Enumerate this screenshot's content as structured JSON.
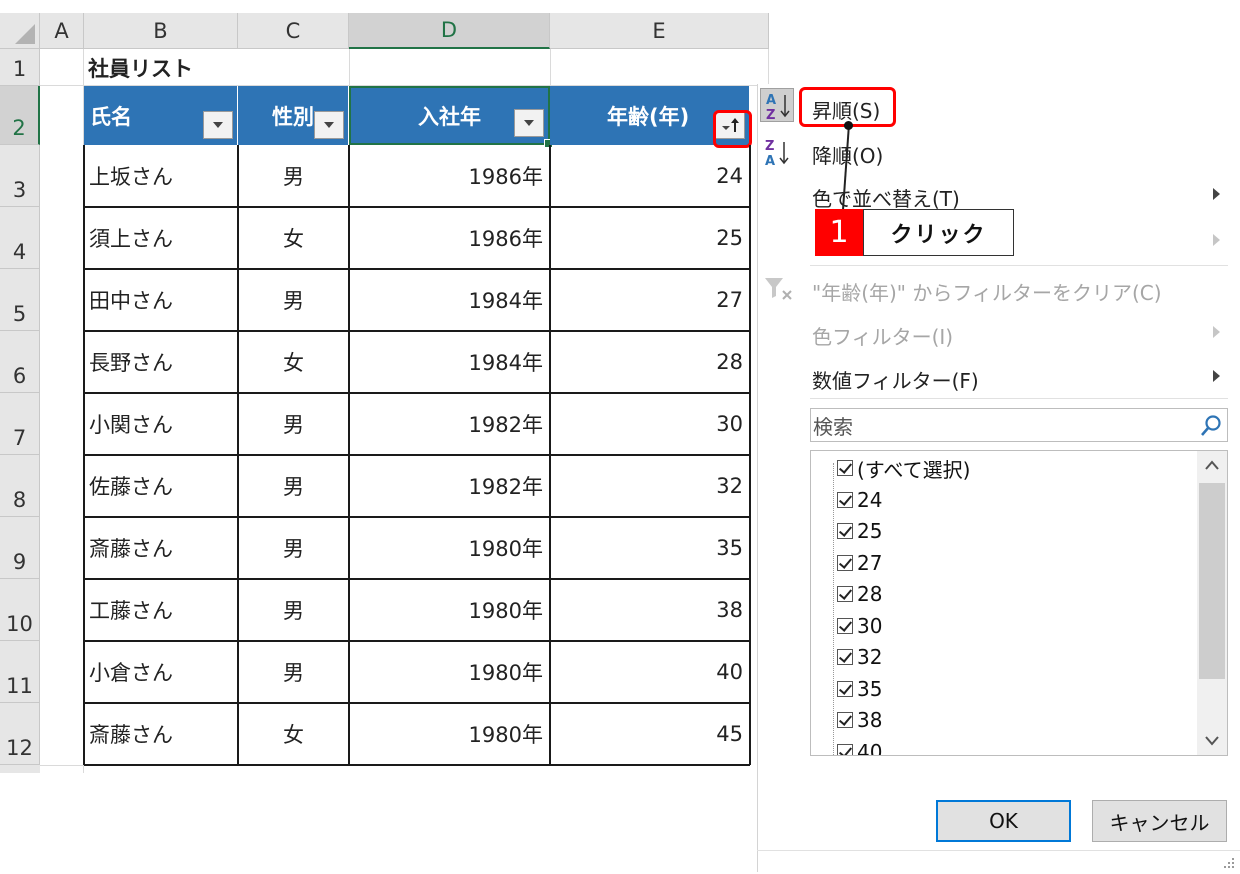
{
  "sheet": {
    "col_headers": [
      "A",
      "B",
      "C",
      "D",
      "E"
    ],
    "row_headers": [
      "1",
      "2",
      "3",
      "4",
      "5",
      "6",
      "7",
      "8",
      "9",
      "10",
      "11",
      "12"
    ],
    "title": "社員リスト",
    "table_headers": [
      "氏名",
      "性別",
      "入社年",
      "年齢(年)"
    ],
    "rows": [
      {
        "name": "上坂さん",
        "gender": "男",
        "year": "1986年",
        "age": "24"
      },
      {
        "name": "須上さん",
        "gender": "女",
        "year": "1986年",
        "age": "25"
      },
      {
        "name": "田中さん",
        "gender": "男",
        "year": "1984年",
        "age": "27"
      },
      {
        "name": "長野さん",
        "gender": "女",
        "year": "1984年",
        "age": "28"
      },
      {
        "name": "小関さん",
        "gender": "男",
        "year": "1982年",
        "age": "30"
      },
      {
        "name": "佐藤さん",
        "gender": "男",
        "year": "1982年",
        "age": "32"
      },
      {
        "name": "斎藤さん",
        "gender": "男",
        "year": "1980年",
        "age": "35"
      },
      {
        "name": "工藤さん",
        "gender": "男",
        "year": "1980年",
        "age": "38"
      },
      {
        "name": "小倉さん",
        "gender": "男",
        "year": "1980年",
        "age": "40"
      },
      {
        "name": "斎藤さん",
        "gender": "女",
        "year": "1980年",
        "age": "45"
      }
    ]
  },
  "menu": {
    "sort_asc": "昇順(S)",
    "sort_desc": "降順(O)",
    "sort_by_color": "色で並べ替え(T)",
    "clear_filter": "\"年齢(年)\" からフィルターをクリア(C)",
    "color_filter": "色フィルター(I)",
    "number_filter": "数値フィルター(F)",
    "search_placeholder": "検索",
    "list_items": [
      "(すべて選択)",
      "24",
      "25",
      "27",
      "28",
      "30",
      "32",
      "35",
      "38",
      "40"
    ],
    "ok_label": "OK",
    "cancel_label": "キャンセル"
  },
  "annotation": {
    "step_number": "1",
    "step_text": "クリック"
  },
  "colors": {
    "header_fill": "#2e74b5",
    "highlight": "#ff0000",
    "ok_border": "#0078d7"
  }
}
